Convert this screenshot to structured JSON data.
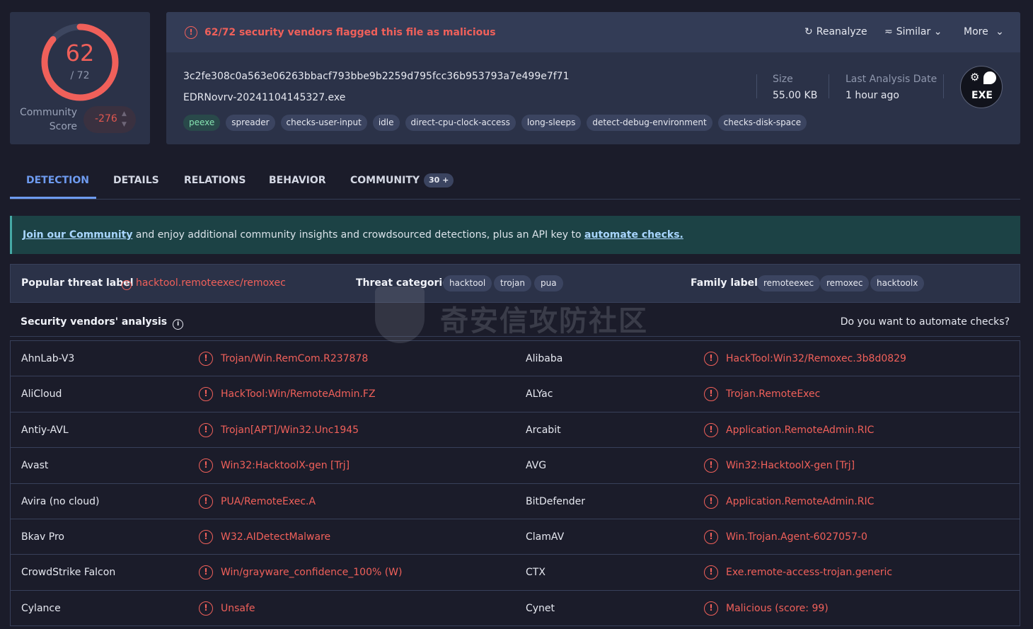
{
  "score": {
    "detections": "62",
    "total": "/ 72",
    "ratio": 0.861,
    "community_label_1": "Community",
    "community_label_2": "Score",
    "community_value": "-276",
    "color": "#f0605a"
  },
  "header": {
    "alert_text": "62/72 security vendors flagged this file as malicious",
    "reanalyze": "Reanalyze",
    "similar": "Similar",
    "more": "More",
    "hash": "3c2fe308c0a563e06263bbacf793bbe9b2259d795fcc36b953793a7e499e7f71",
    "filename": "EDRNovrv-20241104145327.exe",
    "tags": [
      "peexe",
      "spreader",
      "checks-user-input",
      "idle",
      "direct-cpu-clock-access",
      "long-sleeps",
      "detect-debug-environment",
      "checks-disk-space"
    ],
    "size_label": "Size",
    "size_value": "55.00 KB",
    "date_label": "Last Analysis Date",
    "date_value": "1 hour ago",
    "filetype": "EXE"
  },
  "tabs": {
    "detection": "DETECTION",
    "details": "DETAILS",
    "relations": "RELATIONS",
    "behavior": "BEHAVIOR",
    "community": "COMMUNITY",
    "community_count": "30 +"
  },
  "promo": {
    "link1": "Join our Community",
    "middle": " and enjoy additional community insights and crowdsourced detections, plus an API key to ",
    "link2": "automate checks."
  },
  "threat": {
    "popular_label": "Popular threat label",
    "popular_value": "hacktool.remoteexec/remoxec",
    "categories_label": "Threat categories",
    "categories": [
      "hacktool",
      "trojan",
      "pua"
    ],
    "family_label": "Family labels",
    "families": [
      "remoteexec",
      "remoxec",
      "hacktoolx"
    ]
  },
  "vendors_head": {
    "title": "Security vendors' analysis",
    "automate": "Do you want to automate checks?"
  },
  "vendors": [
    {
      "left_name": "AhnLab-V3",
      "left_result": "Trojan/Win.RemCom.R237878",
      "right_name": "Alibaba",
      "right_result": "HackTool:Win32/Remoxec.3b8d0829"
    },
    {
      "left_name": "AliCloud",
      "left_result": "HackTool:Win/RemoteAdmin.FZ",
      "right_name": "ALYac",
      "right_result": "Trojan.RemoteExec"
    },
    {
      "left_name": "Antiy-AVL",
      "left_result": "Trojan[APT]/Win32.Unc1945",
      "right_name": "Arcabit",
      "right_result": "Application.RemoteAdmin.RIC"
    },
    {
      "left_name": "Avast",
      "left_result": "Win32:HacktoolX-gen [Trj]",
      "right_name": "AVG",
      "right_result": "Win32:HacktoolX-gen [Trj]"
    },
    {
      "left_name": "Avira (no cloud)",
      "left_result": "PUA/RemoteExec.A",
      "right_name": "BitDefender",
      "right_result": "Application.RemoteAdmin.RIC"
    },
    {
      "left_name": "Bkav Pro",
      "left_result": "W32.AIDetectMalware",
      "right_name": "ClamAV",
      "right_result": "Win.Trojan.Agent-6027057-0"
    },
    {
      "left_name": "CrowdStrike Falcon",
      "left_result": "Win/grayware_confidence_100% (W)",
      "right_name": "CTX",
      "right_result": "Exe.remote-access-trojan.generic"
    },
    {
      "left_name": "Cylance",
      "left_result": "Unsafe",
      "right_name": "Cynet",
      "right_result": "Malicious (score: 99)"
    }
  ],
  "watermark": "奇安信攻防社区"
}
